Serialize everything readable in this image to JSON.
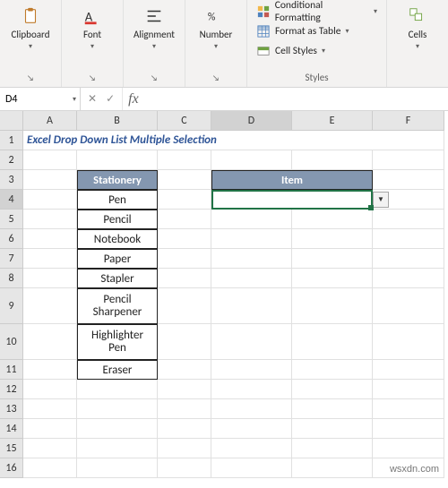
{
  "ribbon": {
    "clipboard": {
      "label": "Clipboard"
    },
    "font": {
      "label": "Font"
    },
    "alignment": {
      "label": "Alignment"
    },
    "number": {
      "label": "Number"
    },
    "styles": {
      "label": "Styles",
      "cond": "Conditional Formatting",
      "table": "Format as Table",
      "cell": "Cell Styles"
    },
    "cells": {
      "label": "Cells"
    }
  },
  "namebox": {
    "ref": "D4"
  },
  "fx": {
    "cancel": "✕",
    "confirm": "✓",
    "label": "fx",
    "formula": ""
  },
  "columns": [
    "A",
    "B",
    "C",
    "D",
    "E",
    "F"
  ],
  "rows": [
    "1",
    "2",
    "3",
    "4",
    "5",
    "6",
    "7",
    "8",
    "9",
    "10",
    "11",
    "12",
    "13",
    "14",
    "15",
    "16"
  ],
  "title": "Excel Drop Down List Multiple Selection",
  "table": {
    "header": "Stationery",
    "items": [
      "Pen",
      "Pencil",
      "Notebook",
      "Paper",
      "Stapler",
      "Pencil Sharpener",
      "Highlighter Pen",
      "Eraser"
    ]
  },
  "item": {
    "header": "Item",
    "value": ""
  },
  "watermark": "wsxdn.com"
}
